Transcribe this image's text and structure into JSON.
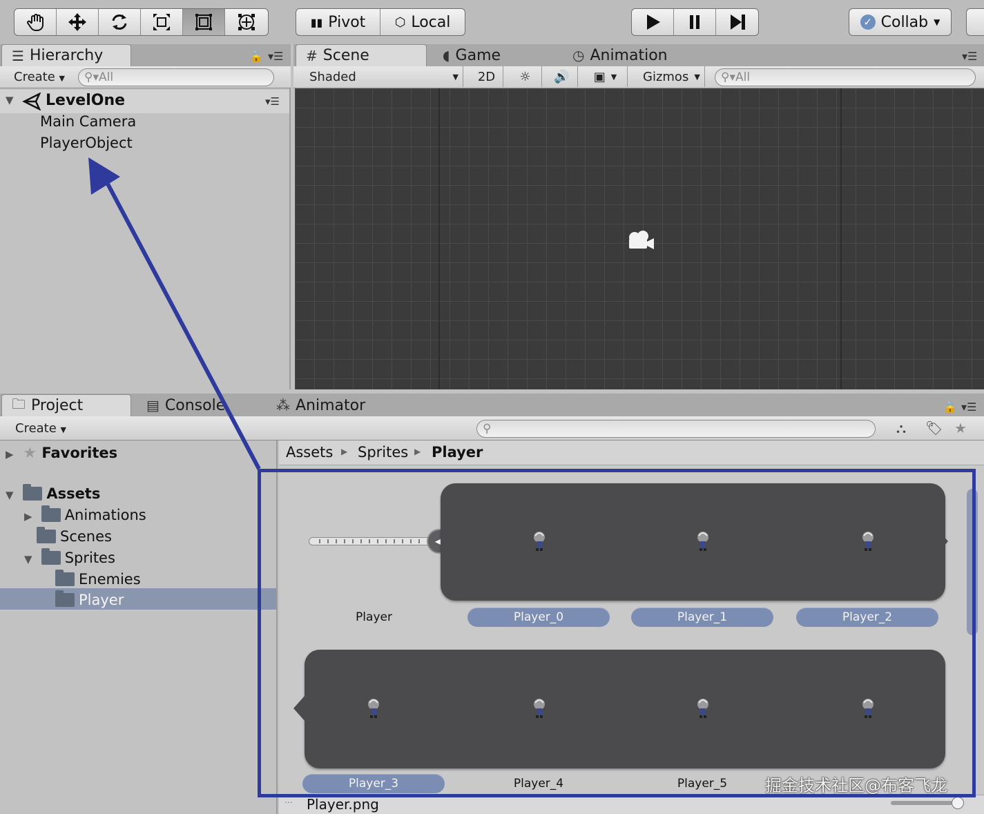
{
  "toolbar": {
    "tools": [
      {
        "icon": "hand-icon"
      },
      {
        "icon": "move-icon"
      },
      {
        "icon": "rotate-icon"
      },
      {
        "icon": "scale-icon"
      },
      {
        "icon": "rect-tool-icon"
      },
      {
        "icon": "transform-tool-icon"
      }
    ],
    "pivot_label": "Pivot",
    "local_label": "Local",
    "collab_label": "Collab"
  },
  "hierarchy": {
    "tab_label": "Hierarchy",
    "create_label": "Create",
    "search_placeholder": "All",
    "scene_name": "LevelOne",
    "items": [
      "Main Camera",
      "PlayerObject"
    ]
  },
  "scene_view": {
    "tabs": {
      "scene": "Scene",
      "game": "Game",
      "animation": "Animation"
    },
    "shading_mode": "Shaded",
    "mode_2d": "2D",
    "gizmos_label": "Gizmos",
    "search_placeholder": "All"
  },
  "project": {
    "tabs": {
      "project": "Project",
      "console": "Console",
      "animator": "Animator"
    },
    "create_label": "Create",
    "favorites_label": "Favorites",
    "assets_label": "Assets",
    "folders": {
      "animations": "Animations",
      "scenes": "Scenes",
      "sprites": "Sprites",
      "enemies": "Enemies",
      "player": "Player"
    },
    "breadcrumb": [
      "Assets",
      "Sprites",
      "Player"
    ],
    "parent_asset_label": "Player",
    "sprites": [
      "Player_0",
      "Player_1",
      "Player_2",
      "Player_3",
      "Player_4",
      "Player_5"
    ],
    "footer_file": "Player.png"
  },
  "watermark": "掘金技术社区@布客飞龙",
  "colors": {
    "highlight_box": "#2e3a9c",
    "selected_row": "#8a96ae",
    "pill": "#7b8db3"
  }
}
